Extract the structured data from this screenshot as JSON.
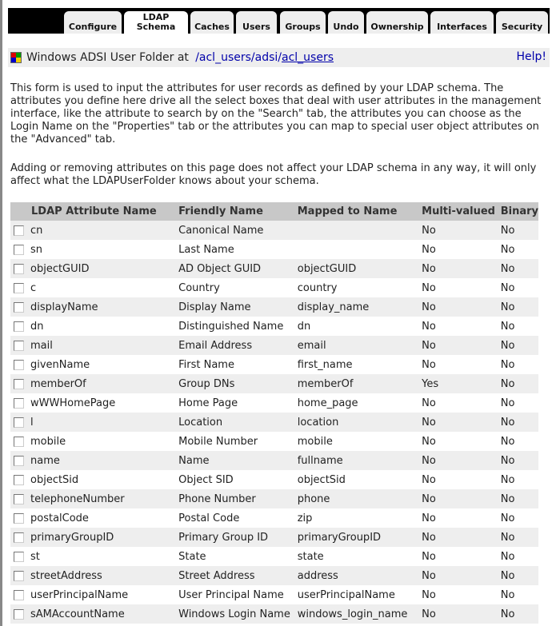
{
  "tabs": [
    {
      "label": "Configure"
    },
    {
      "label": "LDAP\nSchema",
      "active": true
    },
    {
      "label": "Caches"
    },
    {
      "label": "Users"
    },
    {
      "label": "Groups"
    },
    {
      "label": "Undo"
    },
    {
      "label": "Ownership"
    },
    {
      "label": "Interfaces"
    },
    {
      "label": "Security"
    }
  ],
  "header": {
    "title": "Windows ADSI User Folder at",
    "path1": "/acl_users",
    "sep1": "/",
    "path2": "adsi",
    "sep2": "/",
    "path3": "acl_users",
    "help": "Help!"
  },
  "intro": "This form is used to input the attributes for user records as defined by your LDAP schema. The attributes you define here drive all the select boxes that deal with user attributes in the management interface, like the attribute to search by on the \"Search\" tab, the attributes you can choose as the Login Name on the \"Properties\" tab or the attributes you can map to special user object attributes on the \"Advanced\" tab.",
  "note": "Adding or removing attributes on this page does not affect your LDAP schema in any way, it will only affect what the LDAPUserFolder knows about your schema.",
  "table": {
    "headers": [
      "LDAP Attribute Name",
      "Friendly Name",
      "Mapped to Name",
      "Multi-valued",
      "Binary"
    ],
    "rows": [
      [
        "cn",
        "Canonical Name",
        "",
        "No",
        "No"
      ],
      [
        "sn",
        "Last Name",
        "",
        "No",
        "No"
      ],
      [
        "objectGUID",
        "AD Object GUID",
        "objectGUID",
        "No",
        "No"
      ],
      [
        "c",
        "Country",
        "country",
        "No",
        "No"
      ],
      [
        "displayName",
        "Display Name",
        "display_name",
        "No",
        "No"
      ],
      [
        "dn",
        "Distinguished Name",
        "dn",
        "No",
        "No"
      ],
      [
        "mail",
        "Email Address",
        "email",
        "No",
        "No"
      ],
      [
        "givenName",
        "First Name",
        "first_name",
        "No",
        "No"
      ],
      [
        "memberOf",
        "Group DNs",
        "memberOf",
        "Yes",
        "No"
      ],
      [
        "wWWHomePage",
        "Home Page",
        "home_page",
        "No",
        "No"
      ],
      [
        "l",
        "Location",
        "location",
        "No",
        "No"
      ],
      [
        "mobile",
        "Mobile Number",
        "mobile",
        "No",
        "No"
      ],
      [
        "name",
        "Name",
        "fullname",
        "No",
        "No"
      ],
      [
        "objectSid",
        "Object SID",
        "objectSid",
        "No",
        "No"
      ],
      [
        "telephoneNumber",
        "Phone Number",
        "phone",
        "No",
        "No"
      ],
      [
        "postalCode",
        "Postal Code",
        "zip",
        "No",
        "No"
      ],
      [
        "primaryGroupID",
        "Primary Group ID",
        "primaryGroupID",
        "No",
        "No"
      ],
      [
        "st",
        "State",
        "state",
        "No",
        "No"
      ],
      [
        "streetAddress",
        "Street Address",
        "address",
        "No",
        "No"
      ],
      [
        "userPrincipalName",
        "User Principal Name",
        "userPrincipalName",
        "No",
        "No"
      ],
      [
        "sAMAccountName",
        "Windows Login Name",
        "windows_login_name",
        "No",
        "No"
      ]
    ]
  }
}
